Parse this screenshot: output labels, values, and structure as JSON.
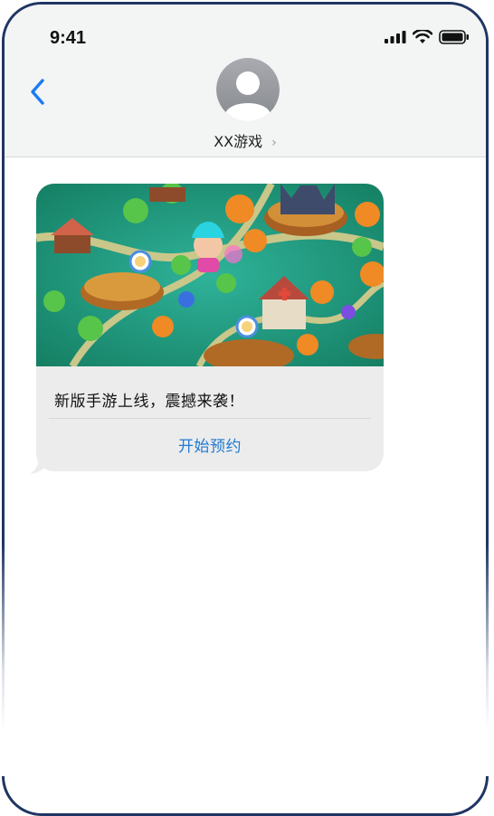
{
  "status_bar": {
    "time": "9:41",
    "signal_icon": "cellular-signal-icon",
    "wifi_icon": "wifi-icon",
    "battery_icon": "battery-icon"
  },
  "header": {
    "back_icon": "chevron-left-icon",
    "avatar_icon": "person-avatar-icon",
    "contact_name": "XX游戏",
    "contact_chevron": "›"
  },
  "message": {
    "image_alt": "game-map-illustration",
    "text": "新版手游上线，震撼来袭！",
    "action_label": "开始预约"
  },
  "colors": {
    "frame": "#1f3563",
    "header_bg": "#f3f4f4",
    "bubble_bg": "#ececec",
    "link_blue": "#1f7ad1",
    "back_blue": "#1a7cf0"
  }
}
